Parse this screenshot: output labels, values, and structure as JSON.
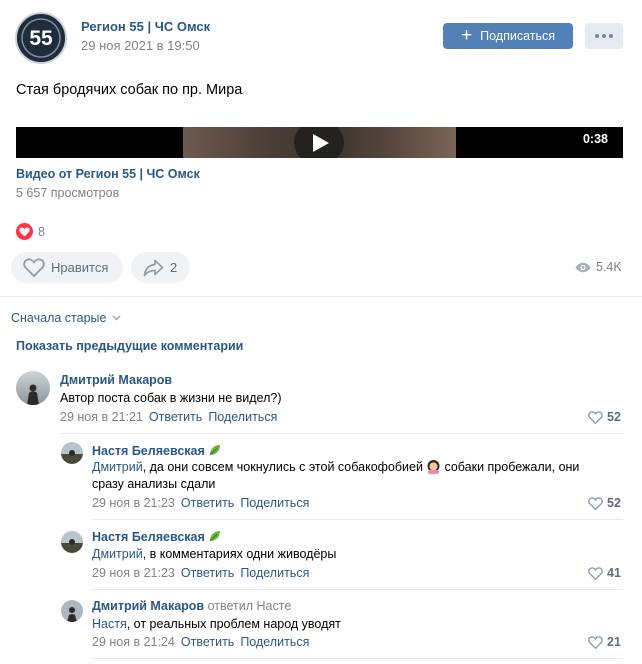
{
  "post": {
    "author": "Регион 55 | ЧС Омск",
    "date": "29 ноя 2021 в 19:50",
    "subscribe_label": "Подписаться",
    "text": "Стая бродячих собак по пр. Мира",
    "video": {
      "duration": "0:38",
      "title": "Видео от Регион 55 | ЧС Омск",
      "views": "5 657 просмотров"
    },
    "reaction_count": "8",
    "like_label": "Нравится",
    "share_count": "2",
    "views_total": "5.4K"
  },
  "comments_section": {
    "sort_label": "Сначала старые",
    "show_previous": "Показать предыдущие комментарии"
  },
  "comments": [
    {
      "name": "Дмитрий Макаров",
      "text": "Автор поста собак в жизни не видел?)",
      "date": "29 ноя в 21:21",
      "reply_label": "Ответить",
      "share_label": "Поделиться",
      "likes": "52"
    },
    {
      "name": "Настя Беляевская",
      "mention": "Дмитрий",
      "text_line1": ", да они совсем чокнулись с этой собакофобией",
      "text_line1_tail": " собаки пробежали, они",
      "text_line2": "сразу анализы сдали",
      "date": "29 ноя в 21:23",
      "reply_label": "Ответить",
      "share_label": "Поделиться",
      "likes": "52"
    },
    {
      "name": "Настя Беляевская",
      "mention": "Дмитрий",
      "text": ", в комментариях одни живодёры",
      "date": "29 ноя в 21:23",
      "reply_label": "Ответить",
      "share_label": "Поделиться",
      "likes": "41"
    },
    {
      "name": "Дмитрий Макаров",
      "replied_to": "ответил Насте",
      "mention": "Настя",
      "text": ", от реальных проблем народ уводят",
      "date": "29 ноя в 21:24",
      "reply_label": "Ответить",
      "share_label": "Поделиться",
      "likes": "21"
    }
  ],
  "logo_text": "55",
  "colors": {
    "accent": "#5181b8",
    "link": "#2a5885",
    "muted": "#828282",
    "heart": "#ff3347"
  },
  "icons": [
    "plus-icon",
    "more-icon",
    "play-icon",
    "heart-icon",
    "like-icon",
    "share-icon",
    "eye-icon",
    "chevron-down-icon",
    "leaf-icon",
    "woman-emoji-icon"
  ]
}
